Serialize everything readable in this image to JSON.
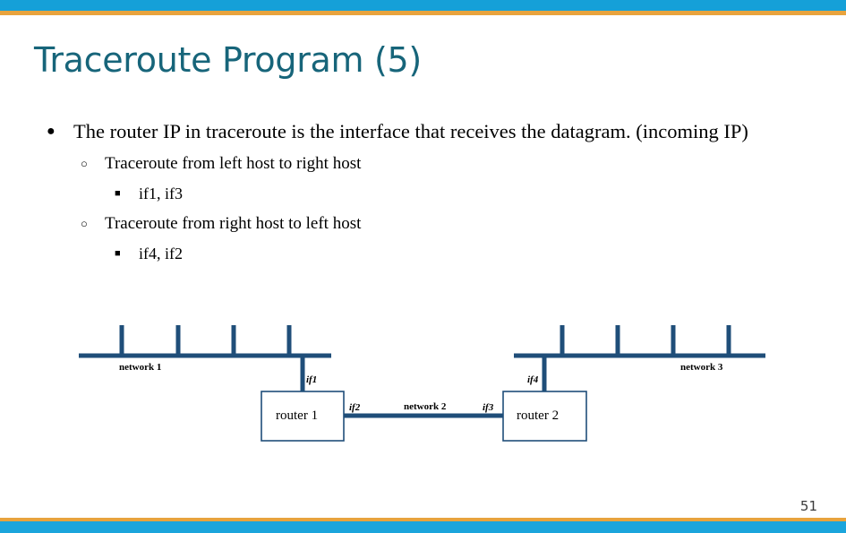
{
  "slide": {
    "title": "Traceroute Program (5)",
    "page_number": "51",
    "accent_blue": "#15A0D8",
    "accent_gold": "#E8A33D",
    "title_color": "#17657A",
    "diagram_color": "#1F4E79"
  },
  "bullets": {
    "level1": {
      "marker": "●",
      "text": "The router IP in traceroute is the interface that receives the datagram. (incoming IP)"
    },
    "items": [
      {
        "marker": "○",
        "text": "Traceroute from left host to right host",
        "sub": {
          "marker": "■",
          "text": "if1, if3"
        }
      },
      {
        "marker": "○",
        "text": "Traceroute from right host to left host",
        "sub": {
          "marker": "■",
          "text": "if4, if2"
        }
      }
    ]
  },
  "diagram": {
    "networks": [
      {
        "id": "network1",
        "label": "network 1"
      },
      {
        "id": "network2",
        "label": "network 2"
      },
      {
        "id": "network3",
        "label": "network 3"
      }
    ],
    "routers": [
      {
        "id": "router1",
        "label": "router 1"
      },
      {
        "id": "router2",
        "label": "router 2"
      }
    ],
    "interfaces": [
      {
        "id": "if1",
        "label": "if1"
      },
      {
        "id": "if2",
        "label": "if2"
      },
      {
        "id": "if3",
        "label": "if3"
      },
      {
        "id": "if4",
        "label": "if4"
      }
    ]
  }
}
